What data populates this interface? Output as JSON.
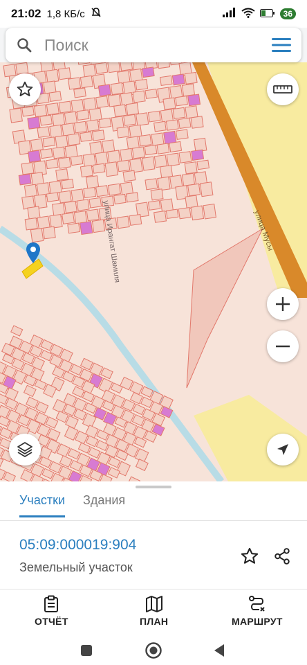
{
  "status_bar": {
    "time": "21:02",
    "speed": "1,8 КБ/с",
    "battery": "36"
  },
  "search": {
    "placeholder": "Поиск"
  },
  "map": {
    "street_1": "улица Ирангат Шамиля",
    "street_2": "улица Мусы",
    "colors": {
      "background": "#f7e3d9",
      "parcel_fill": "#f4d2c6",
      "parcel_stroke": "#e2786b",
      "zone_yellow": "#f8eba0",
      "highway": "#d9892a",
      "road": "#b8dce6",
      "marker": "#1f76c8",
      "selected": "#f5d21f"
    }
  },
  "tabs": [
    {
      "label": "Участки",
      "active": true
    },
    {
      "label": "Здания",
      "active": false
    }
  ],
  "parcel": {
    "number": "05:09:000019:904",
    "type": "Земельный участок"
  },
  "actions": {
    "report": "ОТЧЁТ",
    "plan": "ПЛАН",
    "route": "МАРШРУТ"
  },
  "accent_color": "#2b7fbf"
}
